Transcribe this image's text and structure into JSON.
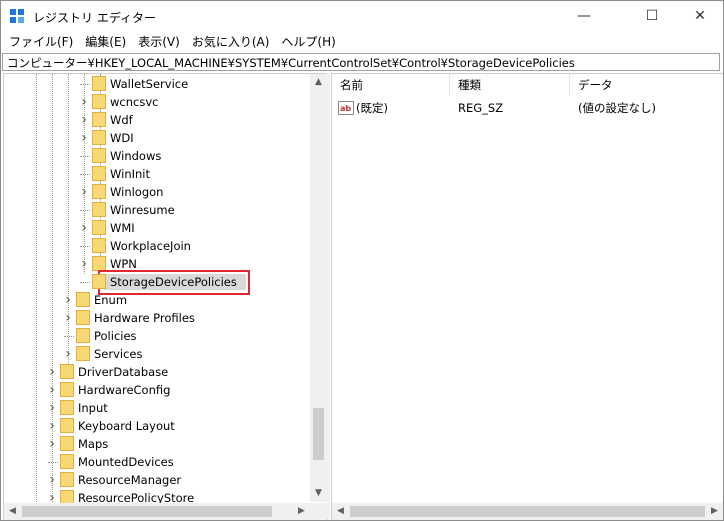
{
  "window": {
    "title": "レジストリ エディター"
  },
  "controls": {
    "minimize": "—",
    "maximize": "☐",
    "close": "✕"
  },
  "menu": [
    "ファイル(F)",
    "編集(E)",
    "表示(V)",
    "お気に入り(A)",
    "ヘルプ(H)"
  ],
  "address": "コンピューター¥HKEY_LOCAL_MACHINE¥SYSTEM¥CurrentControlSet¥Control¥StorageDevicePolicies",
  "tree": [
    {
      "label": "WalletService",
      "expander": false
    },
    {
      "label": "wcncsvc",
      "expander": true
    },
    {
      "label": "Wdf",
      "expander": true
    },
    {
      "label": "WDI",
      "expander": true
    },
    {
      "label": "Windows",
      "expander": false
    },
    {
      "label": "WinInit",
      "expander": false
    },
    {
      "label": "Winlogon",
      "expander": true
    },
    {
      "label": "Winresume",
      "expander": false
    },
    {
      "label": "WMI",
      "expander": true
    },
    {
      "label": "WorkplaceJoin",
      "expander": false
    },
    {
      "label": "WPN",
      "expander": true
    },
    {
      "label": "StorageDevicePolicies",
      "expander": false,
      "selected": true
    },
    {
      "label": "Enum",
      "expander": true
    },
    {
      "label": "Hardware Profiles",
      "expander": true
    },
    {
      "label": "Policies",
      "expander": false
    },
    {
      "label": "Services",
      "expander": true
    },
    {
      "label": "DriverDatabase",
      "expander": true
    },
    {
      "label": "HardwareConfig",
      "expander": true
    },
    {
      "label": "Input",
      "expander": true
    },
    {
      "label": "Keyboard Layout",
      "expander": true
    },
    {
      "label": "Maps",
      "expander": true
    },
    {
      "label": "MountedDevices",
      "expander": false
    },
    {
      "label": "ResourceManager",
      "expander": true
    },
    {
      "label": "ResourcePolicyStore",
      "expander": true
    }
  ],
  "list": {
    "columns": [
      "名前",
      "種類",
      "データ"
    ],
    "rows": [
      {
        "name": "(既定)",
        "type": "REG_SZ",
        "data": "(値の設定なし)",
        "icon": "ab-string-icon"
      }
    ]
  },
  "colors": {
    "folder": "#f8d775",
    "folder_edge": "#e0b23c",
    "highlight_border": "#e0262e",
    "icon_blue": "#1e78d6"
  }
}
